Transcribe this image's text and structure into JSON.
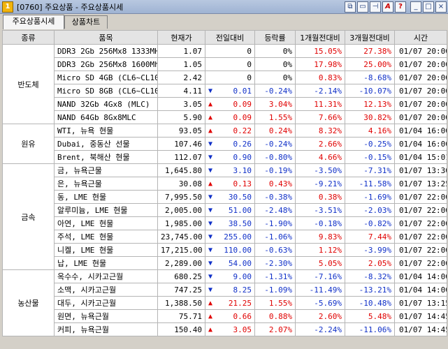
{
  "window": {
    "title": "[0760] 주요상품 - 주요상품시세",
    "app_icon": "1"
  },
  "tabs": [
    {
      "label": "주요상품시세"
    },
    {
      "label": "상품차트"
    }
  ],
  "headers": [
    "종류",
    "품목",
    "현재가",
    "전일대비",
    "등락률",
    "1개월전대비",
    "3개월전대비",
    "시간"
  ],
  "groups": [
    {
      "category": "반도체",
      "rows": [
        {
          "item": "DDR3 2Gb 256Mx8 1333MHz",
          "price": "1.07",
          "dir": "",
          "change": "0",
          "rate": "0%",
          "m1": "15.05%",
          "m3": "27.38%",
          "time": "01/07 20:00"
        },
        {
          "item": "DDR3 2Gb 256Mx8 1600Mhz",
          "price": "1.05",
          "dir": "",
          "change": "0",
          "rate": "0%",
          "m1": "17.98%",
          "m3": "25.00%",
          "time": "01/07 20:00"
        },
        {
          "item": "Micro SD 4GB (CL6~CL10)",
          "price": "2.42",
          "dir": "",
          "change": "0",
          "rate": "0%",
          "m1": "0.83%",
          "m3": "-8.68%",
          "time": "01/07 20:00"
        },
        {
          "item": "Micro SD 8GB (CL6~CL10)",
          "price": "4.11",
          "dir": "down",
          "change": "0.01",
          "rate": "-0.24%",
          "m1": "-2.14%",
          "m3": "-10.07%",
          "time": "01/07 20:00"
        },
        {
          "item": "NAND 32Gb 4Gx8 (MLC)",
          "price": "3.05",
          "dir": "up",
          "change": "0.09",
          "rate": "3.04%",
          "m1": "11.31%",
          "m3": "12.13%",
          "time": "01/07 20:00"
        },
        {
          "item": "NAND 64Gb 8Gx8MLC",
          "price": "5.90",
          "dir": "up",
          "change": "0.09",
          "rate": "1.55%",
          "m1": "7.66%",
          "m3": "30.82%",
          "time": "01/07 20:00"
        }
      ]
    },
    {
      "category": "원유",
      "rows": [
        {
          "item": "WTI, 뉴욕 현물",
          "price": "93.05",
          "dir": "up",
          "change": "0.22",
          "rate": "0.24%",
          "m1": "8.32%",
          "m3": "4.16%",
          "time": "01/04 16:00"
        },
        {
          "item": "Dubai, 중동산 선물",
          "price": "107.46",
          "dir": "down",
          "change": "0.26",
          "rate": "-0.24%",
          "m1": "2.66%",
          "m3": "-0.25%",
          "time": "01/04 16:00"
        },
        {
          "item": "Brent, 북해산 현물",
          "price": "112.07",
          "dir": "down",
          "change": "0.90",
          "rate": "-0.80%",
          "m1": "4.66%",
          "m3": "-0.15%",
          "time": "01/04 15:01"
        }
      ]
    },
    {
      "category": "금속",
      "rows": [
        {
          "item": "금, 뉴욕근물",
          "price": "1,645.80",
          "dir": "down",
          "change": "3.10",
          "rate": "-0.19%",
          "m1": "-3.50%",
          "m3": "-7.31%",
          "time": "01/07 13:30"
        },
        {
          "item": "은, 뉴욕근물",
          "price": "30.08",
          "dir": "up",
          "change": "0.13",
          "rate": "0.43%",
          "m1": "-9.21%",
          "m3": "-11.58%",
          "time": "01/07 13:25"
        },
        {
          "item": "동, LME 현물",
          "price": "7,995.50",
          "dir": "down",
          "change": "30.50",
          "rate": "-0.38%",
          "m1": "0.38%",
          "m3": "-1.69%",
          "time": "01/07 22:00"
        },
        {
          "item": "알루미늄, LME 현물",
          "price": "2,005.00",
          "dir": "down",
          "change": "51.00",
          "rate": "-2.48%",
          "m1": "-3.51%",
          "m3": "-2.03%",
          "time": "01/07 22:00"
        },
        {
          "item": "아연, LME 현물",
          "price": "1,985.00",
          "dir": "down",
          "change": "38.50",
          "rate": "-1.90%",
          "m1": "-0.18%",
          "m3": "-0.82%",
          "time": "01/07 22:00"
        },
        {
          "item": "주석, LME 현물",
          "price": "23,745.00",
          "dir": "down",
          "change": "255.00",
          "rate": "-1.06%",
          "m1": "9.83%",
          "m3": "7.44%",
          "time": "01/07 22:00"
        },
        {
          "item": "니켈, LME 현물",
          "price": "17,215.00",
          "dir": "down",
          "change": "110.00",
          "rate": "-0.63%",
          "m1": "1.12%",
          "m3": "-3.99%",
          "time": "01/07 22:00"
        },
        {
          "item": "납, LME 현물",
          "price": "2,289.00",
          "dir": "down",
          "change": "54.00",
          "rate": "-2.30%",
          "m1": "5.05%",
          "m3": "2.05%",
          "time": "01/07 22:00"
        }
      ]
    },
    {
      "category": "농산물",
      "rows": [
        {
          "item": "옥수수, 시카고근월",
          "price": "680.25",
          "dir": "down",
          "change": "9.00",
          "rate": "-1.31%",
          "m1": "-7.16%",
          "m3": "-8.32%",
          "time": "01/04 14:00"
        },
        {
          "item": "소맥, 시카고근월",
          "price": "747.25",
          "dir": "down",
          "change": "8.25",
          "rate": "-1.09%",
          "m1": "-11.49%",
          "m3": "-13.21%",
          "time": "01/04 14:00"
        },
        {
          "item": "대두, 시카고근월",
          "price": "1,388.50",
          "dir": "up",
          "change": "21.25",
          "rate": "1.55%",
          "m1": "-5.69%",
          "m3": "-10.48%",
          "time": "01/07 13:15"
        },
        {
          "item": "원면, 뉴욕근월",
          "price": "75.71",
          "dir": "up",
          "change": "0.66",
          "rate": "0.88%",
          "m1": "2.60%",
          "m3": "5.48%",
          "time": "01/07 14:45"
        },
        {
          "item": "커피, 뉴욕근월",
          "price": "150.40",
          "dir": "up",
          "change": "3.05",
          "rate": "2.07%",
          "m1": "-2.24%",
          "m3": "-11.06%",
          "time": "01/07 14:45"
        }
      ]
    }
  ]
}
